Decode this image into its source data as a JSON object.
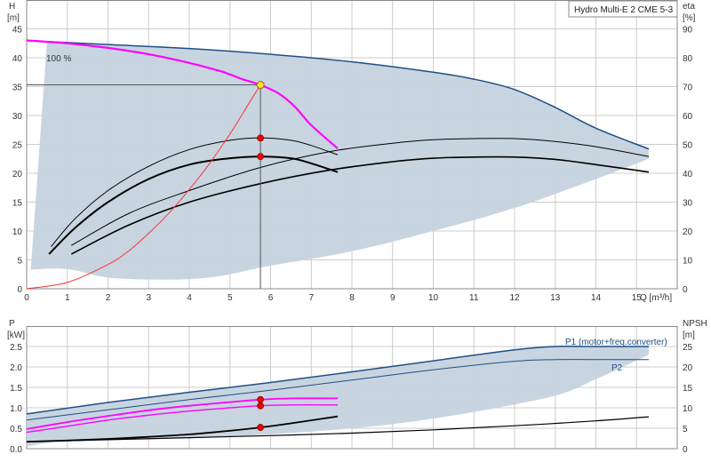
{
  "chart_data": [
    {
      "type": "line",
      "title": "Hydro Multi-E 2 CME 5-3",
      "xlabel": "Q [m³/h]",
      "xlabel_text": "Q [m³/h]",
      "xlim": [
        0,
        16
      ],
      "x_ticks": [
        "0",
        "1",
        "2",
        "3",
        "4",
        "5",
        "6",
        "7",
        "8",
        "9",
        "10",
        "11",
        "12",
        "13",
        "14",
        "15"
      ],
      "ylabel_left": [
        "H",
        "[m]"
      ],
      "ylim_left": [
        0,
        50
      ],
      "y_ticks_left": [
        "0",
        "5",
        "10",
        "15",
        "20",
        "25",
        "30",
        "35",
        "40",
        "45"
      ],
      "ylabel_right": [
        "eta",
        "[%]"
      ],
      "ylim_right": [
        0,
        100
      ],
      "y_ticks_right": [
        "0",
        "10",
        "20",
        "30",
        "40",
        "50",
        "60",
        "70",
        "80",
        "90"
      ],
      "annotations": [
        "100 %"
      ],
      "grid": true,
      "colors": {
        "envelope_fill": "#c5d3de",
        "envelope_line": "#1e4f86",
        "selected": "#ff00ff",
        "system": "#ff3333",
        "marker": "#ee0000",
        "duty_marker": "#ffdd33"
      },
      "envelope_max_head": {
        "x": [
          0.5,
          2,
          4,
          6,
          8,
          10,
          11,
          12,
          13,
          14,
          15.3
        ],
        "y": [
          42.8,
          42.3,
          41.6,
          40.6,
          39.3,
          37.5,
          36.3,
          34.5,
          31.4,
          27.8,
          24.2
        ]
      },
      "envelope_min": {
        "x": [
          0.1,
          1,
          2.2,
          4.3,
          6,
          8,
          10,
          12,
          14,
          15.3
        ],
        "y": [
          3.3,
          3.4,
          1.8,
          1.8,
          4,
          6.5,
          10,
          14,
          19,
          22.5
        ]
      },
      "series": [
        {
          "x": [
            0,
            1,
            2,
            3,
            4,
            4.8,
            5.3,
            5.75,
            6.2,
            6.6,
            7.0,
            7.65
          ],
          "y": [
            43,
            42.5,
            41.7,
            40.6,
            39.1,
            37.6,
            36.3,
            35.3,
            33.8,
            31.5,
            28.3,
            24.3
          ]
        },
        {
          "x": [
            0.6,
            1.2,
            2,
            3,
            4,
            5,
            5.75,
            6.5,
            7.0,
            7.65
          ],
          "y": [
            7.3,
            12.2,
            17,
            21.2,
            24.1,
            25.7,
            26.1,
            25.7,
            24.8,
            23.2
          ]
        },
        {
          "x": [
            0.55,
            1.2,
            2,
            3,
            4,
            5,
            5.75,
            6.5,
            7.0,
            7.65
          ],
          "y": [
            6.0,
            10.6,
            15,
            19,
            21.5,
            22.6,
            22.9,
            22.6,
            21.7,
            20.2
          ]
        },
        {
          "x": [
            1.1,
            2.5,
            4,
            5.75,
            7.5,
            9,
            10,
            11,
            12,
            13,
            14,
            15.3
          ],
          "y": [
            7.5,
            13,
            17,
            21,
            23.8,
            25.2,
            25.8,
            26.0,
            26.0,
            25.5,
            24.6,
            22.9
          ]
        },
        {
          "x": [
            1.1,
            2.5,
            4,
            5.75,
            7.5,
            9,
            10,
            11,
            12,
            13,
            14,
            15.3
          ],
          "y": [
            6.0,
            11,
            15,
            18.2,
            20.6,
            22.0,
            22.6,
            22.8,
            22.8,
            22.4,
            21.5,
            20.2
          ]
        },
        {
          "x": [
            0,
            1,
            2,
            2.5,
            3,
            3.5,
            4,
            4.5,
            5,
            5.5,
            5.75
          ],
          "y": [
            0,
            1.1,
            4.2,
            6.5,
            9.6,
            13.1,
            17.2,
            21.7,
            26.8,
            32.5,
            35.3
          ]
        }
      ],
      "markers": [
        {
          "x": 5.75,
          "y": 26.1
        },
        {
          "x": 5.75,
          "y": 22.9
        }
      ],
      "duty_point": {
        "x": 5.75,
        "y": 35.3
      }
    },
    {
      "type": "line",
      "xlim": [
        0,
        16
      ],
      "ylabel_left": [
        "P",
        "[kW]"
      ],
      "ylim_left": [
        0,
        3
      ],
      "y_ticks_left": [
        "0.0",
        "0.5",
        "1.0",
        "1.5",
        "2.0",
        "2.5"
      ],
      "ylabel_right": [
        "NPSH",
        "[m]"
      ],
      "ylim_right": [
        0,
        30
      ],
      "y_ticks_right": [
        "0",
        "5",
        "10",
        "15",
        "20",
        "25"
      ],
      "series_labels": [
        "P1 (motor+freq.converter)",
        "P2"
      ],
      "grid": true,
      "envelope_upper": {
        "x": [
          0,
          2,
          4,
          6,
          8,
          10,
          12,
          13,
          14,
          15.3
        ],
        "y": [
          0.85,
          1.13,
          1.38,
          1.62,
          1.88,
          2.15,
          2.42,
          2.5,
          2.5,
          2.5
        ]
      },
      "envelope_lower": {
        "x": [
          0,
          1,
          3,
          5,
          7,
          9,
          11,
          13,
          14,
          15.3
        ],
        "y": [
          0.05,
          0.2,
          0.25,
          0.3,
          0.42,
          0.6,
          0.9,
          1.3,
          1.7,
          2.3
        ]
      },
      "series": [
        {
          "x": [
            0,
            2,
            4,
            6,
            8,
            10,
            12,
            13,
            14,
            15.3
          ],
          "y": [
            0.85,
            1.13,
            1.38,
            1.62,
            1.88,
            2.15,
            2.42,
            2.5,
            2.5,
            2.5
          ]
        },
        {
          "x": [
            0,
            2,
            4,
            6,
            8,
            10,
            12,
            13,
            14,
            15.3
          ],
          "y": [
            0.7,
            0.95,
            1.2,
            1.43,
            1.68,
            1.93,
            2.14,
            2.18,
            2.18,
            2.18
          ]
        },
        {
          "x": [
            0,
            1,
            2,
            3,
            4,
            5,
            5.75,
            6.5,
            7.65
          ],
          "y": [
            0.48,
            0.65,
            0.8,
            0.94,
            1.05,
            1.14,
            1.2,
            1.23,
            1.23
          ]
        },
        {
          "x": [
            0,
            1,
            2,
            3,
            4,
            5,
            5.75,
            6.5,
            7.65
          ],
          "y": [
            0.4,
            0.55,
            0.7,
            0.82,
            0.92,
            1.0,
            1.05,
            1.07,
            1.07
          ]
        },
        {
          "x": [
            0,
            1,
            2,
            3,
            4,
            5,
            5.75,
            6.5,
            7.65
          ],
          "y": [
            0.17,
            0.2,
            0.24,
            0.29,
            0.35,
            0.44,
            0.52,
            0.62,
            0.79
          ]
        },
        {
          "x": [
            0,
            2,
            4,
            6,
            8,
            10,
            12,
            14,
            15.3
          ],
          "y": [
            0.17,
            0.22,
            0.27,
            0.32,
            0.38,
            0.46,
            0.56,
            0.68,
            0.78
          ]
        }
      ],
      "markers": [
        {
          "x": 5.75,
          "y": 1.2
        },
        {
          "x": 5.75,
          "y": 1.05
        },
        {
          "x": 5.75,
          "y": 0.52
        }
      ]
    }
  ]
}
